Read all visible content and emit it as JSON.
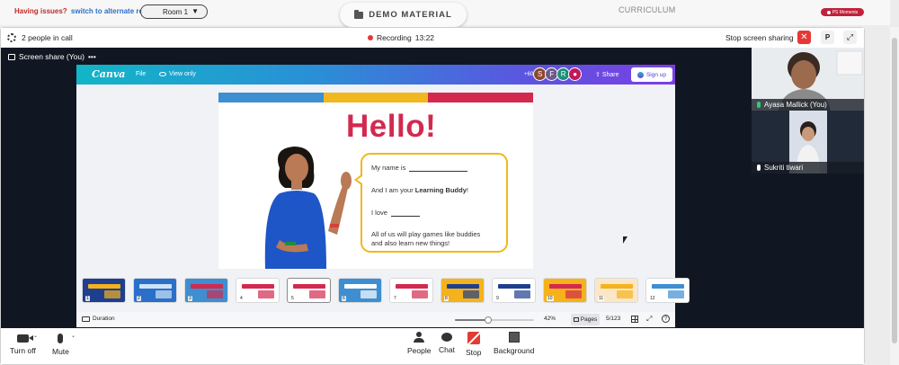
{
  "topbar": {
    "issues_text": "Having issues?",
    "alternate_link": "switch to alternate room",
    "room_select": "Room 1",
    "demo_tab": "DEMO MATERIAL",
    "curriculum": "CURRICULUM",
    "ps_moments": "PS Moments"
  },
  "callbar": {
    "people_in_call": "2 people in call",
    "recording_label": "Recording",
    "recording_time": "13:22",
    "stop_sharing": "Stop screen sharing",
    "p_button": "P"
  },
  "share": {
    "label": "Screen share (You)",
    "menu": "•••"
  },
  "canva": {
    "logo": "Canva",
    "file": "File",
    "view_only": "View only",
    "avatar_count": "+60",
    "avatars": [
      {
        "letter": "S",
        "color": "#8a4a2f"
      },
      {
        "letter": "F",
        "color": "#6d5a8a"
      },
      {
        "letter": "R",
        "color": "#1f8f7a"
      },
      {
        "letter": "●",
        "color": "#c2185b"
      }
    ],
    "share": "Share",
    "sign_up": "Sign up",
    "duration": "Duration",
    "zoom": "42%",
    "zoom_level": 0.42,
    "pages": "Pages",
    "page_count": "5/123",
    "help": "?"
  },
  "slide": {
    "title": "Hello!",
    "line1": "My name is",
    "line2_prefix": "And I am your",
    "line2_bold": "Learning Buddy",
    "line2_suffix": "!",
    "line3": "I love",
    "line4a": "All of us will play games like buddies",
    "line4b": "and also learn new things!",
    "stripe_colors": [
      "#3d8fd1",
      "#f0b71e",
      "#d3294f"
    ]
  },
  "thumbnails": [
    {
      "num": "1",
      "bg": "#1e3f8f",
      "accent": "#f5b21a"
    },
    {
      "num": "2",
      "bg": "#2a6fc9",
      "accent": "#cfe3f7"
    },
    {
      "num": "3",
      "bg": "#3d8fd1",
      "accent": "#d3294f"
    },
    {
      "num": "4",
      "bg": "#ffffff",
      "accent": "#d3294f"
    },
    {
      "num": "5",
      "bg": "#ffffff",
      "accent": "#d3294f"
    },
    {
      "num": "6",
      "bg": "#3d8fd1",
      "accent": "#ffffff"
    },
    {
      "num": "7",
      "bg": "#ffffff",
      "accent": "#d3294f"
    },
    {
      "num": "8",
      "bg": "#f5b21a",
      "accent": "#1e3f8f"
    },
    {
      "num": "9",
      "bg": "#ffffff",
      "accent": "#1e3f8f"
    },
    {
      "num": "10",
      "bg": "#f5b21a",
      "accent": "#d3294f"
    },
    {
      "num": "11",
      "bg": "#fbe7c8",
      "accent": "#f5b21a"
    },
    {
      "num": "12",
      "bg": "#ffffff",
      "accent": "#3d8fd1"
    }
  ],
  "participants": [
    {
      "name": "Ayasa Mallick (You)"
    },
    {
      "name": "Sukriti tiwari"
    }
  ],
  "toolbar": {
    "turn_off": "Turn off",
    "mute": "Mute",
    "people": "People",
    "chat": "Chat",
    "stop": "Stop",
    "background": "Background"
  }
}
